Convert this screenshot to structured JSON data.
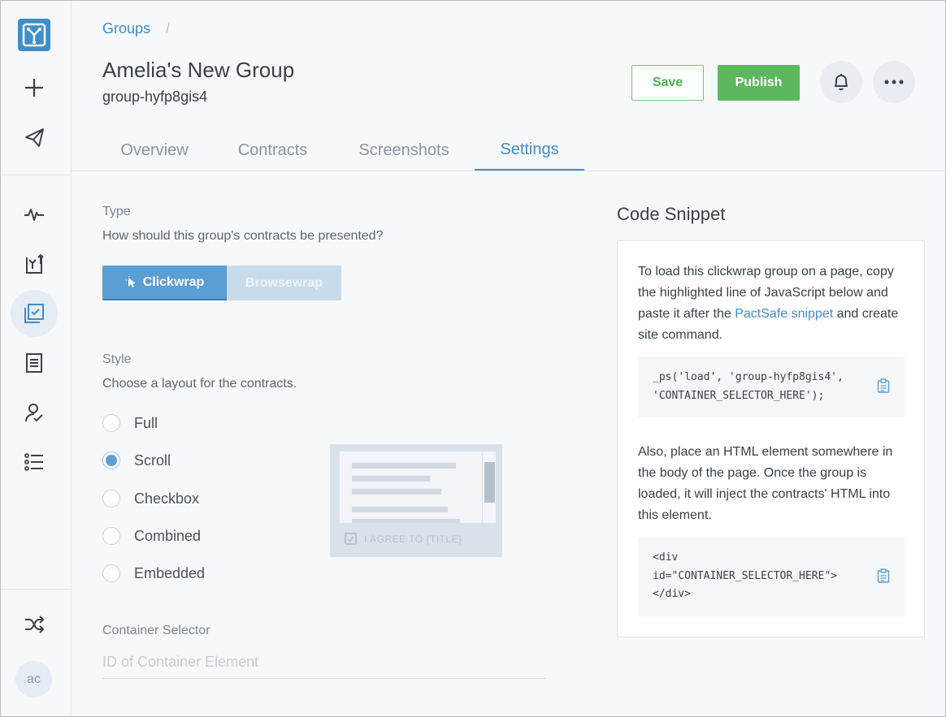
{
  "sidebar": {
    "logo": "pactsafe-logo-icon",
    "top_items": [
      "plus-icon",
      "send-icon"
    ],
    "nav_items": [
      "activity-icon",
      "contracts-upload-icon",
      "groups-icon",
      "document-icon",
      "signer-icon",
      "list-icon"
    ],
    "active_item": "groups-icon",
    "bottom_items": [
      "shuffle-icon"
    ],
    "avatar_initials": "ac"
  },
  "header": {
    "breadcrumb": {
      "link": "Groups",
      "separator": "/"
    },
    "title": "Amelia's New Group",
    "subtitle": "group-hyfp8gis4",
    "save_label": "Save",
    "publish_label": "Publish"
  },
  "tabs": [
    {
      "label": "Overview",
      "active": false
    },
    {
      "label": "Contracts",
      "active": false
    },
    {
      "label": "Screenshots",
      "active": false
    },
    {
      "label": "Settings",
      "active": true
    }
  ],
  "settings": {
    "type": {
      "label": "Type",
      "description": "How should this group's contracts be presented?",
      "options": [
        "Clickwrap",
        "Browsewrap"
      ],
      "selected": "Clickwrap"
    },
    "style": {
      "label": "Style",
      "description": "Choose a layout for the contracts.",
      "options": [
        "Full",
        "Scroll",
        "Checkbox",
        "Combined",
        "Embedded"
      ],
      "selected": "Scroll",
      "preview_agree_text": "I AGREE TO {TITLE}"
    },
    "container_selector": {
      "label": "Container Selector",
      "placeholder": "ID of Container Element",
      "value": ""
    }
  },
  "code_snippet": {
    "title": "Code Snippet",
    "intro_before": "To load this clickwrap group on a page, copy the highlighted line of JavaScript below and paste it after the ",
    "intro_link": "PactSafe snippet",
    "intro_after": " and create site command.",
    "code1_line1": "_ps('load', 'group-hyfp8gis4',",
    "code1_line2": "'CONTAINER_SELECTOR_HERE');",
    "middle_text": "Also, place an HTML element somewhere in the body of the page. Once the group is loaded, it will inject the contracts' HTML into this element.",
    "code2_line1": "<div",
    "code2_line2": "id=\"CONTAINER_SELECTOR_HERE\">",
    "code2_line3": "</div>"
  },
  "colors": {
    "accent": "#3f8ec9",
    "publish": "#5cb85c",
    "selected_segment": "#5a9ed4"
  }
}
